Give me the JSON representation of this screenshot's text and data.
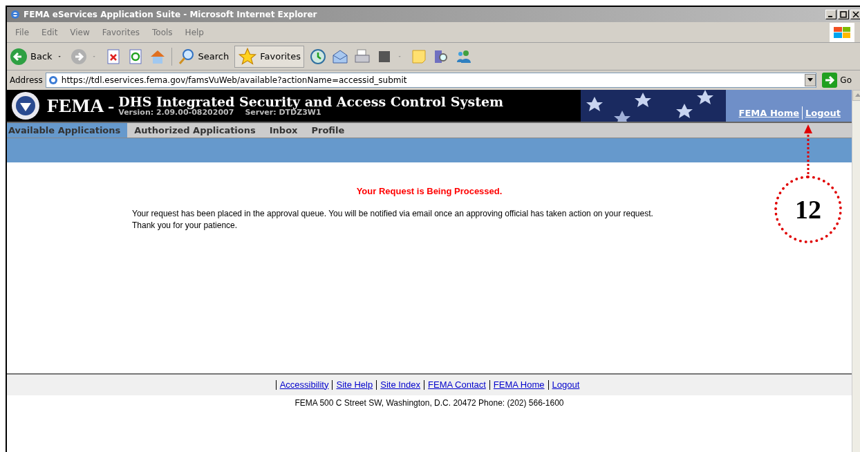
{
  "window": {
    "title": "FEMA eServices Application Suite - Microsoft Internet Explorer"
  },
  "menu": [
    "File",
    "Edit",
    "View",
    "Favorites",
    "Tools",
    "Help"
  ],
  "toolbar": {
    "back": "Back",
    "search": "Search",
    "favorites": "Favorites"
  },
  "address": {
    "label": "Address",
    "value": "https://tdl.eservices.fema.gov/famsVuWeb/available?actionName=accessid_submit",
    "go": "Go"
  },
  "header": {
    "logo": "FEMA -",
    "title": "DHS Integrated Security and Access Control System",
    "version": "Version: 2.09.00-08202007",
    "server": "Server: DTDZ3W1",
    "links": [
      "FEMA Home",
      "Logout"
    ]
  },
  "tabs": [
    {
      "label": "Available Applications",
      "selected": true
    },
    {
      "label": "Authorized Applications",
      "selected": false
    },
    {
      "label": "Inbox",
      "selected": false
    },
    {
      "label": "Profile",
      "selected": false
    }
  ],
  "message": {
    "heading": "Your Request is Being Processed.",
    "lines": [
      "Your request has been placed in the approval queue. You will be notified via email once an approving official has taken action on your request.",
      "Thank you for your patience."
    ]
  },
  "footer": {
    "links": [
      "Accessibility",
      "Site Help",
      "Site Index",
      "FEMA Contact",
      "FEMA Home",
      "Logout"
    ],
    "address": "FEMA 500 C Street SW, Washington, D.C. 20472 Phone: (202) 566-1600"
  },
  "annotation": {
    "label": "12"
  }
}
